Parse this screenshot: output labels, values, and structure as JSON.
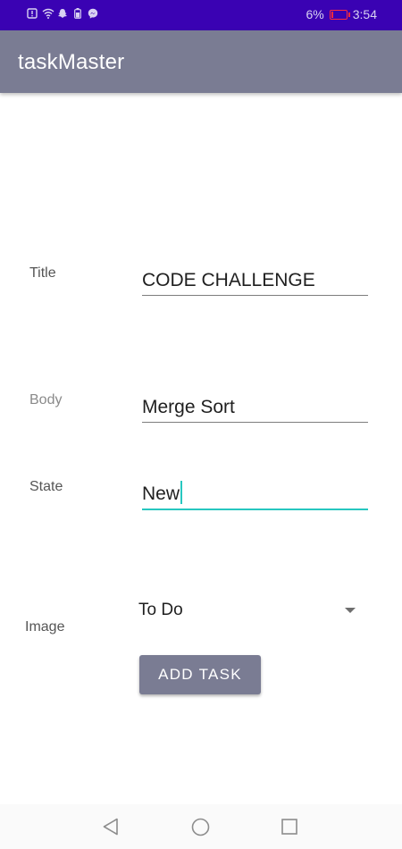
{
  "status_bar": {
    "left_icons": [
      "alert-icon",
      "wifi-icon",
      "snapchat-icon",
      "battery-saver-icon",
      "messenger-icon"
    ],
    "battery_percent": "6%",
    "time": "3:54",
    "battery_color": "#ff2b3d"
  },
  "app_bar": {
    "title": "taskMaster",
    "color": "#7a7c93"
  },
  "form": {
    "title_label": "Title",
    "title_value": "CODE CHALLENGE",
    "body_label": "Body",
    "body_value": "Merge Sort",
    "state_label": "State",
    "state_value": "New",
    "image_label": "Image",
    "image_selected": "To Do",
    "add_button_label": "ADD TASK",
    "focus_color": "#27c7c0"
  },
  "nav_bar": {
    "buttons": [
      "back-icon",
      "home-icon",
      "recents-icon"
    ]
  }
}
